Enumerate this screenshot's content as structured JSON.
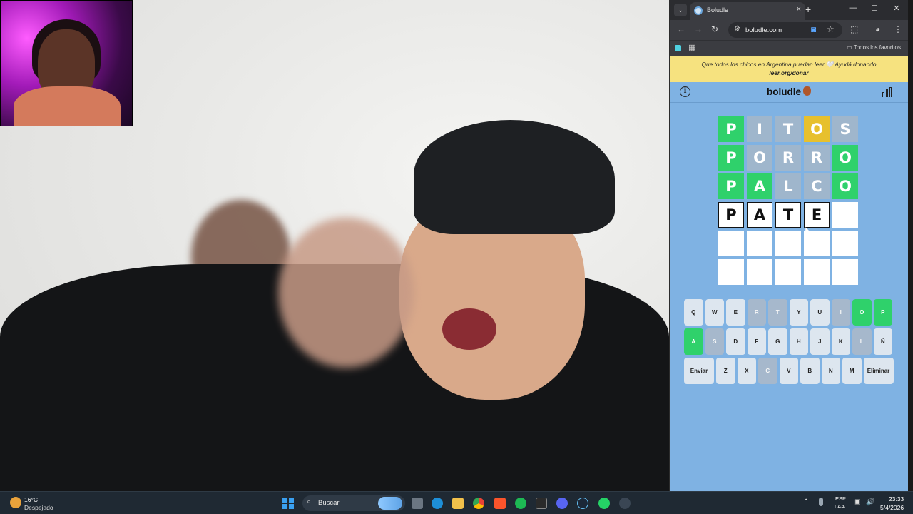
{
  "browser": {
    "tab_title": "Boludle",
    "tab_close": "×",
    "new_tab": "+",
    "window_controls": {
      "minimize": "—",
      "maximize": "☐",
      "close": "✕"
    },
    "nav": {
      "back": "←",
      "forward": "→",
      "reload": "↻"
    },
    "url": "boludle.com",
    "bookmarks_folder": "Todos los favoritos",
    "icons": [
      "tune-icon",
      "star-icon",
      "extensions-icon",
      "profile-icon",
      "menu-icon"
    ]
  },
  "banner": {
    "text": "Que todos los chicos en Argentina puedan leer 🤍 Ayudá donando",
    "link": "leer.org/donar"
  },
  "game": {
    "title": "boludle",
    "info_glyph": "i",
    "colors": {
      "correct": "#2fd16b",
      "present": "#e7c02d",
      "absent": "#9fb6cc",
      "background": "#7fb2e3"
    },
    "board": [
      [
        {
          "letter": "P",
          "state": "correct"
        },
        {
          "letter": "I",
          "state": "absent"
        },
        {
          "letter": "T",
          "state": "absent"
        },
        {
          "letter": "O",
          "state": "present"
        },
        {
          "letter": "S",
          "state": "absent"
        }
      ],
      [
        {
          "letter": "P",
          "state": "correct"
        },
        {
          "letter": "O",
          "state": "absent"
        },
        {
          "letter": "R",
          "state": "absent"
        },
        {
          "letter": "R",
          "state": "absent"
        },
        {
          "letter": "O",
          "state": "correct"
        }
      ],
      [
        {
          "letter": "P",
          "state": "correct"
        },
        {
          "letter": "A",
          "state": "correct"
        },
        {
          "letter": "L",
          "state": "absent"
        },
        {
          "letter": "C",
          "state": "absent"
        },
        {
          "letter": "O",
          "state": "correct"
        }
      ],
      [
        {
          "letter": "P",
          "state": "tbd"
        },
        {
          "letter": "A",
          "state": "tbd"
        },
        {
          "letter": "T",
          "state": "tbd"
        },
        {
          "letter": "E",
          "state": "tbd"
        },
        {
          "letter": "",
          "state": "empty"
        }
      ],
      [
        {
          "letter": "",
          "state": "empty"
        },
        {
          "letter": "",
          "state": "empty"
        },
        {
          "letter": "",
          "state": "empty"
        },
        {
          "letter": "",
          "state": "empty"
        },
        {
          "letter": "",
          "state": "empty"
        }
      ],
      [
        {
          "letter": "",
          "state": "empty"
        },
        {
          "letter": "",
          "state": "empty"
        },
        {
          "letter": "",
          "state": "empty"
        },
        {
          "letter": "",
          "state": "empty"
        },
        {
          "letter": "",
          "state": "empty"
        }
      ]
    ],
    "keyboard": [
      [
        {
          "k": "Q",
          "s": ""
        },
        {
          "k": "W",
          "s": ""
        },
        {
          "k": "E",
          "s": ""
        },
        {
          "k": "R",
          "s": "absent"
        },
        {
          "k": "T",
          "s": "absent"
        },
        {
          "k": "Y",
          "s": ""
        },
        {
          "k": "U",
          "s": ""
        },
        {
          "k": "I",
          "s": "absent"
        },
        {
          "k": "O",
          "s": "correct"
        },
        {
          "k": "P",
          "s": "correct"
        }
      ],
      [
        {
          "k": "A",
          "s": "correct"
        },
        {
          "k": "S",
          "s": "absent"
        },
        {
          "k": "D",
          "s": ""
        },
        {
          "k": "F",
          "s": ""
        },
        {
          "k": "G",
          "s": ""
        },
        {
          "k": "H",
          "s": ""
        },
        {
          "k": "J",
          "s": ""
        },
        {
          "k": "K",
          "s": ""
        },
        {
          "k": "L",
          "s": "absent"
        },
        {
          "k": "Ñ",
          "s": ""
        }
      ],
      [
        {
          "k": "Enviar",
          "s": "",
          "wide": true
        },
        {
          "k": "Z",
          "s": ""
        },
        {
          "k": "X",
          "s": ""
        },
        {
          "k": "C",
          "s": "absent"
        },
        {
          "k": "V",
          "s": ""
        },
        {
          "k": "B",
          "s": ""
        },
        {
          "k": "N",
          "s": ""
        },
        {
          "k": "M",
          "s": ""
        },
        {
          "k": "Eliminar",
          "s": "",
          "wide": true
        }
      ]
    ]
  },
  "taskbar": {
    "temperature": "16°C",
    "condition": "Despejado",
    "search_label": "Buscar",
    "language_top": "ESP",
    "language_bottom": "LAA",
    "time": "23:33",
    "date": "5/4/2026",
    "apps": [
      "file-explorer-icon",
      "folder-icon",
      "edge-icon",
      "chrome-icon",
      "brave-icon",
      "spotify-icon",
      "epic-games-icon",
      "discord-icon",
      "steam-icon",
      "whatsapp-icon",
      "settings-icon"
    ]
  }
}
